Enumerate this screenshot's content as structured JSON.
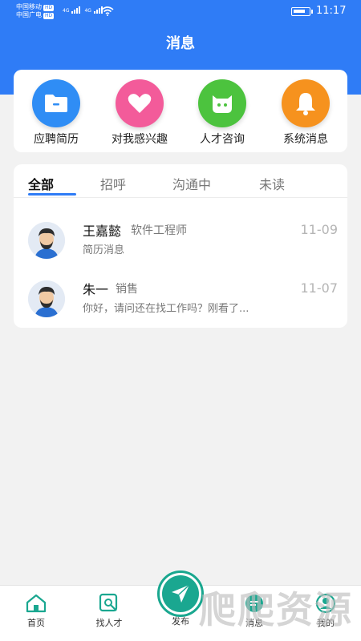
{
  "status_bar": {
    "carrier1": "中国移动",
    "carrier2": "中国广电",
    "hd": "HD",
    "net": "4G",
    "time": "11:17"
  },
  "header": {
    "title": "消息"
  },
  "quick_actions": [
    {
      "label": "应聘简历",
      "icon": "folder-icon",
      "color": "#2f8df5"
    },
    {
      "label": "对我感兴趣",
      "icon": "heart-icon",
      "color": "#f35b9a"
    },
    {
      "label": "人才咨询",
      "icon": "chat-face-icon",
      "color": "#4cc33e"
    },
    {
      "label": "系统消息",
      "icon": "bell-icon",
      "color": "#f6921e"
    }
  ],
  "tabs": [
    {
      "label": "全部",
      "active": true
    },
    {
      "label": "招呼",
      "active": false
    },
    {
      "label": "沟通中",
      "active": false
    },
    {
      "label": "未读",
      "active": false
    }
  ],
  "messages": [
    {
      "name": "王嘉懿",
      "role": "软件工程师",
      "date": "11-09",
      "preview": "简历消息"
    },
    {
      "name": "朱一",
      "role": "销售",
      "date": "11-07",
      "preview": "你好，请问还在找工作吗？刚看了..."
    }
  ],
  "tabbar": {
    "home": "首页",
    "find": "找人才",
    "publish": "发布",
    "messages": "消息",
    "mine": "我的"
  },
  "accent_color": "#2f7cf6"
}
